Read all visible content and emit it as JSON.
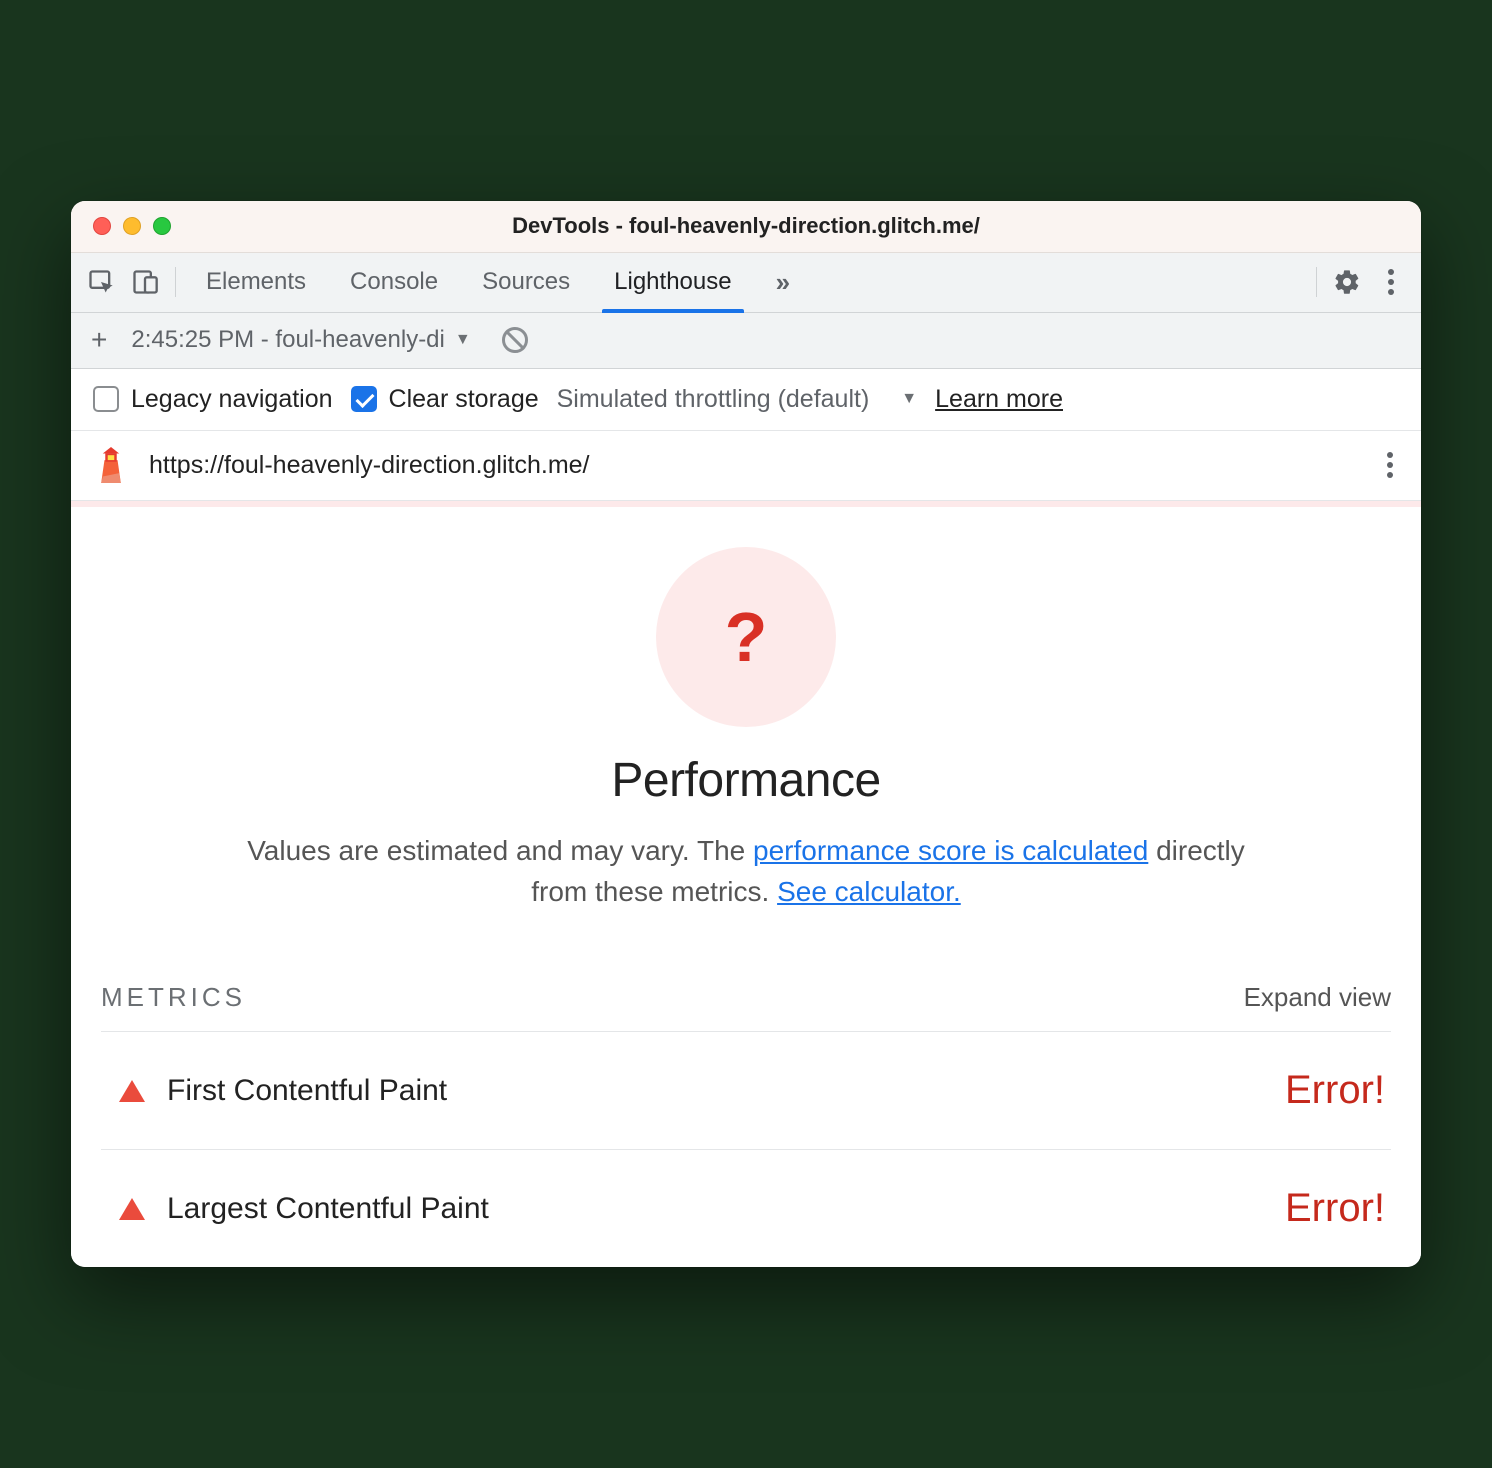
{
  "window": {
    "title": "DevTools - foul-heavenly-direction.glitch.me/"
  },
  "toolbar": {
    "tabs": [
      "Elements",
      "Console",
      "Sources",
      "Lighthouse"
    ],
    "activeTab": "Lighthouse",
    "overflow": "»"
  },
  "subbar": {
    "plus": "+",
    "report_label": "2:45:25 PM - foul-heavenly-di"
  },
  "options": {
    "legacy_label": "Legacy navigation",
    "legacy_checked": false,
    "clear_label": "Clear storage",
    "clear_checked": true,
    "throttling_label": "Simulated throttling (default)",
    "learn_more": "Learn more"
  },
  "urlbar": {
    "url": "https://foul-heavenly-direction.glitch.me/"
  },
  "report": {
    "gauge_text": "?",
    "heading": "Performance",
    "desc_prefix": "Values are estimated and may vary. The ",
    "desc_link1": "performance score is calculated",
    "desc_mid": " directly from these metrics. ",
    "desc_link2": "See calculator."
  },
  "metrics": {
    "section_label": "METRICS",
    "expand_label": "Expand view",
    "items": [
      {
        "name": "First Contentful Paint",
        "value": "Error!"
      },
      {
        "name": "Largest Contentful Paint",
        "value": "Error!"
      }
    ]
  }
}
